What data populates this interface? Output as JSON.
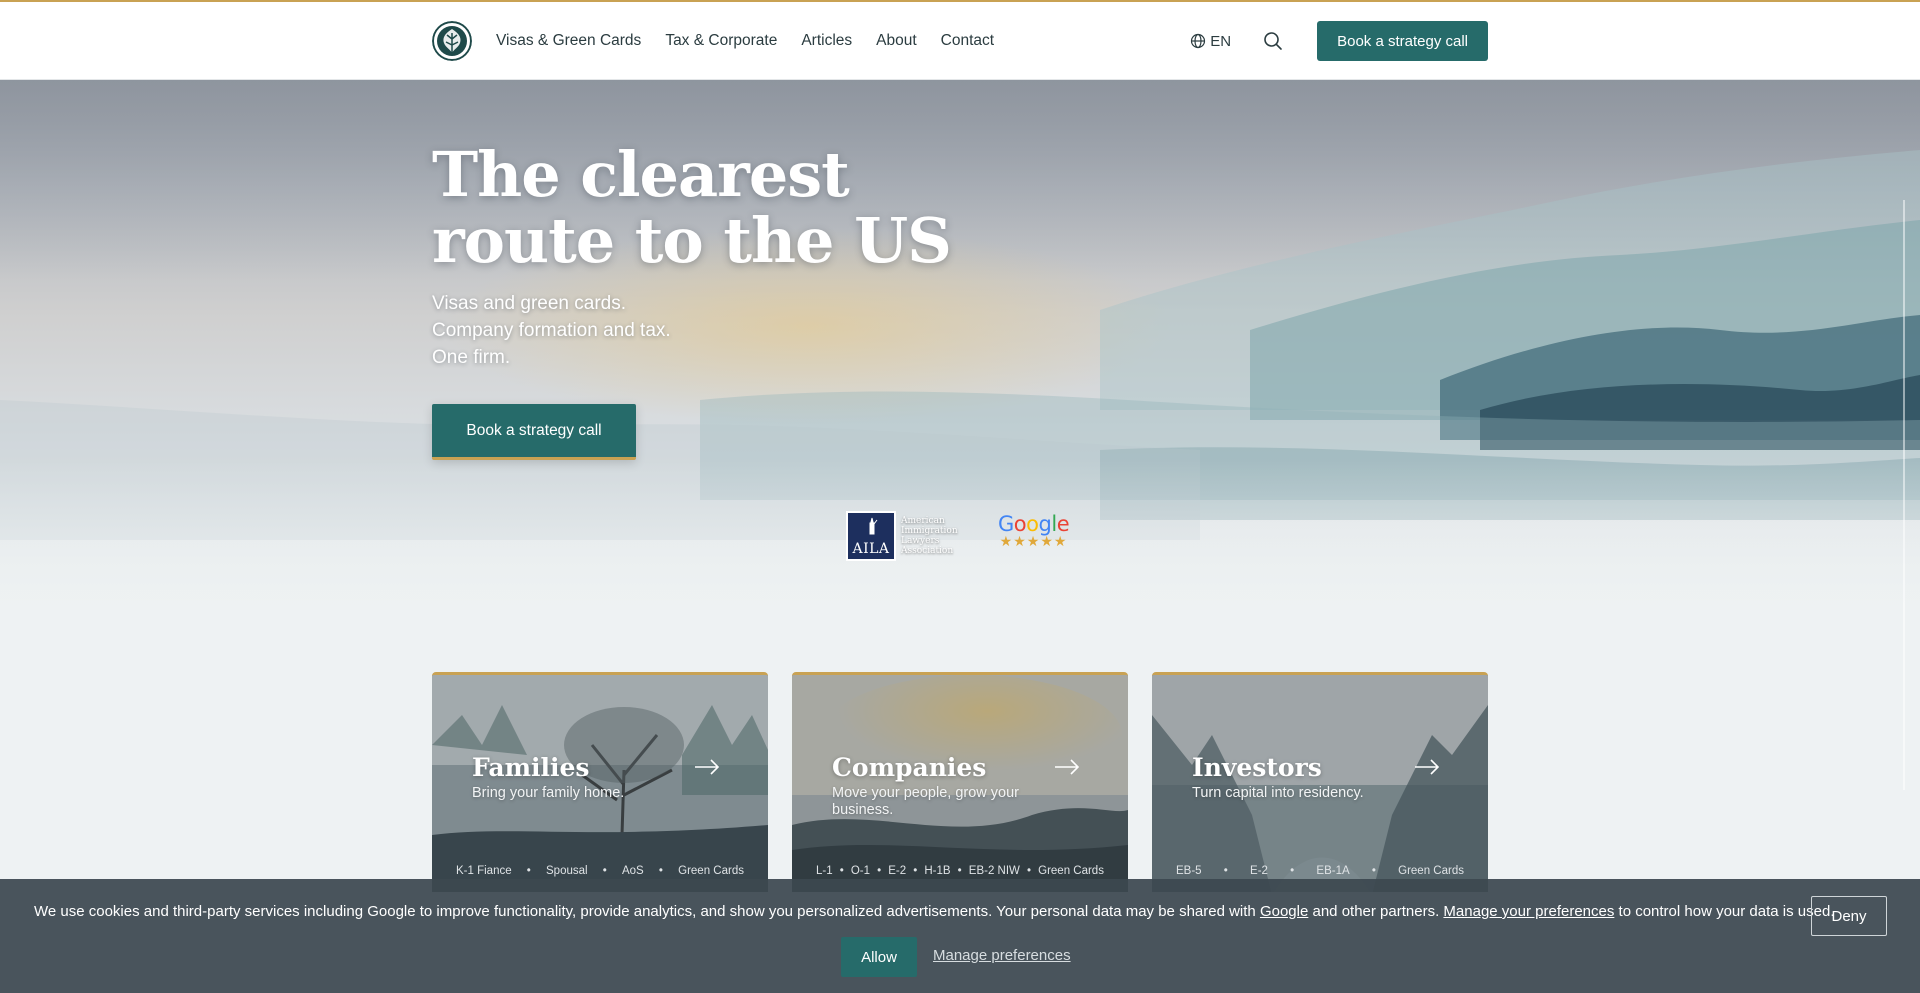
{
  "header": {
    "nav": [
      "Visas & Green Cards",
      "Tax & Corporate",
      "Articles",
      "About",
      "Contact"
    ],
    "lang": "EN",
    "cta": "Book a strategy call"
  },
  "hero": {
    "title_line1": "The clearest",
    "title_line2": "route to the US",
    "sub": [
      "Visas and green cards.",
      "Company formation and tax.",
      "One firm."
    ],
    "cta": "Book a strategy call",
    "aila_logo": "AILA",
    "aila_text": [
      "American",
      "Immigration",
      "Lawyers",
      "Association"
    ],
    "google_word": "Google",
    "google_stars": "★★★★★"
  },
  "cards": [
    {
      "title": "Families",
      "sub": "Bring your family home.",
      "tags": [
        "K-1 Fiance",
        "•",
        "Spousal",
        "•",
        "AoS",
        "•",
        "Green Cards"
      ]
    },
    {
      "title": "Companies",
      "sub": "Move your people, grow your business.",
      "tags": [
        "L-1",
        "•",
        "O-1",
        "•",
        "E-2",
        "•",
        "H-1B",
        "•",
        "EB-2 NIW",
        "•",
        "Green Cards"
      ]
    },
    {
      "title": "Investors",
      "sub": "Turn capital into residency.",
      "tags": [
        "EB-5",
        "•",
        "E-2",
        "•",
        "EB-1A",
        "•",
        "Green Cards"
      ]
    }
  ],
  "cookie": {
    "text_a": "We use cookies and third-party services including Google to improve functionality, provide analytics, and show you personalized advertisements. Your personal data may be shared with ",
    "link_google": "Google",
    "text_b": " and other partners. ",
    "link_manage": "Manage your preferences",
    "text_c": " to control how your data is used.",
    "deny": "Deny",
    "allow": "Allow",
    "manage": "Manage preferences"
  },
  "colors": {
    "brand": "#266b6a",
    "accent": "#c9a253"
  }
}
